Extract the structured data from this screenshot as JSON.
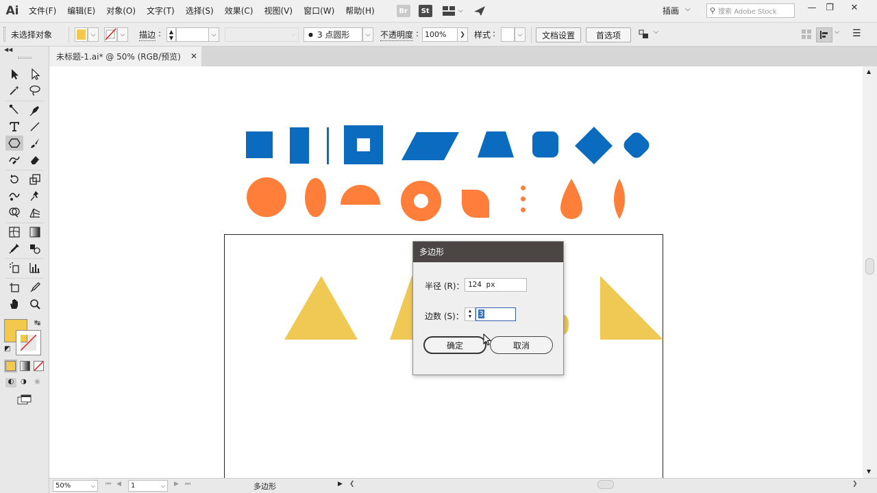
{
  "app": {
    "logo": "Ai",
    "workspace": "插画",
    "search_placeholder": "搜索 Adobe Stock"
  },
  "menu": [
    "文件(F)",
    "编辑(E)",
    "对象(O)",
    "文字(T)",
    "选择(S)",
    "效果(C)",
    "视图(V)",
    "窗口(W)",
    "帮助(H)"
  ],
  "app_buttons": {
    "bridge": "Br",
    "stock": "St"
  },
  "control_bar": {
    "selection_status": "未选择对象",
    "stroke_label": "描边",
    "brush_label": "3 点圆形",
    "opacity_label": "不透明度",
    "opacity_value": "100%",
    "style_label": "样式",
    "doc_setup_button": "文档设置",
    "preferences_button": "首选项"
  },
  "colors": {
    "fill": "#f2c94c",
    "blue": "#0a6bbf",
    "orange": "#ff7f3a",
    "yellow": "#f0c955",
    "dialog_title_bg": "#4b4643"
  },
  "document": {
    "tab_title": "未标题-1.ai* @ 50% (RGB/预览)"
  },
  "status_bar": {
    "zoom": "50%",
    "artboard_number": "1",
    "current_tool": "多边形"
  },
  "dialog": {
    "title": "多边形",
    "radius_label": "半径 (R)：",
    "radius_value": "124 px",
    "sides_label": "边数 (S)：",
    "sides_value": "3",
    "ok_button": "确定",
    "cancel_button": "取消"
  }
}
